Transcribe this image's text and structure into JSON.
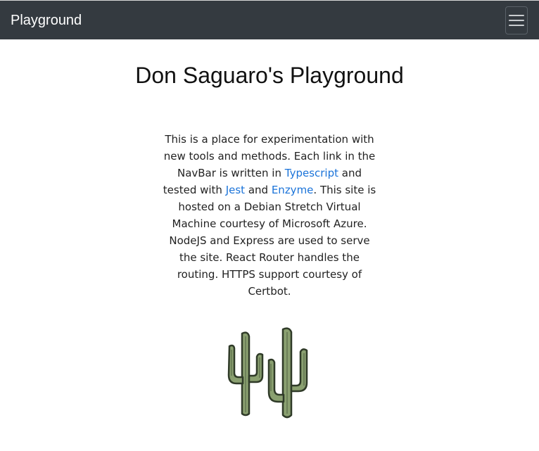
{
  "navbar": {
    "brand": "Playground",
    "toggler_icon": "hamburger-menu-icon"
  },
  "main": {
    "title": "Don Saguaro's Playground",
    "intro": {
      "part1": "This is a place for experimentation with new tools and methods. Each link in the NavBar is written in ",
      "link_typescript": "Typescript",
      "part2": " and tested with ",
      "link_jest": "Jest",
      "part3": " and ",
      "link_enzyme": "Enzyme",
      "part4": ". This site is hosted on a Debian Stretch Virtual Machine courtesy of Microsoft Azure. NodeJS and Express are used to serve the site. React Router handles the routing. HTTPS support courtesy of Certbot."
    },
    "illustration_icon": "saguaro-cactus-icon"
  },
  "colors": {
    "navbar_bg": "#343a40",
    "link": "#1a73d9",
    "cactus_fill": "#8aa070",
    "cactus_outline": "#2f3a28"
  }
}
